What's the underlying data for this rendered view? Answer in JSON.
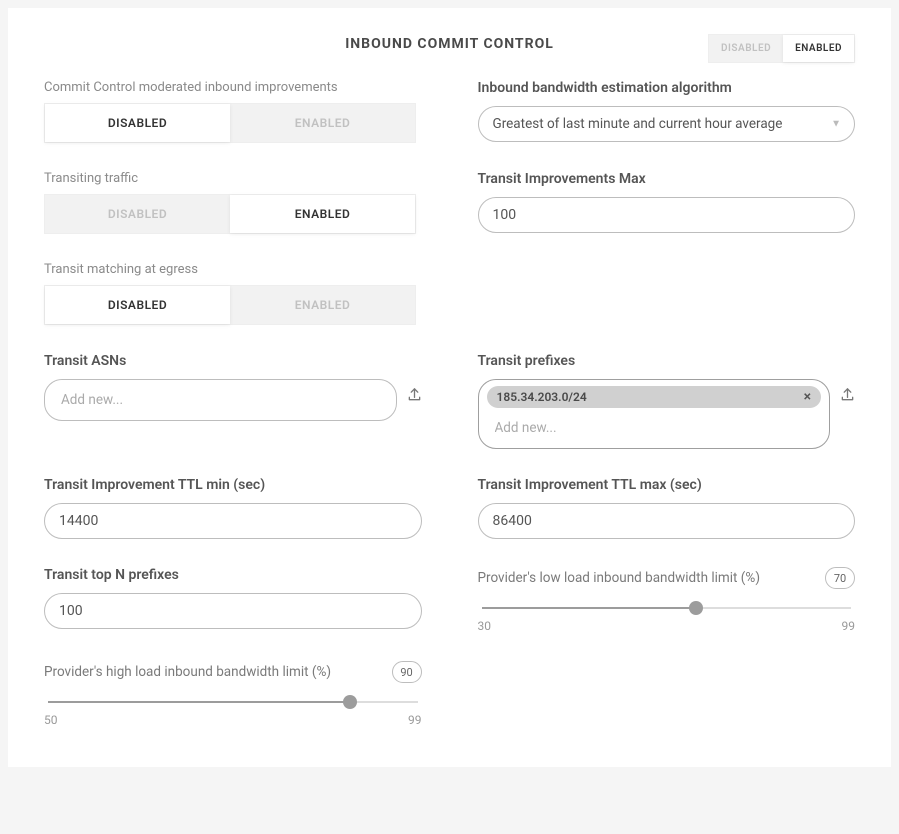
{
  "title": "INBOUND COMMIT CONTROL",
  "header_toggle": {
    "disabled": "DISABLED",
    "enabled": "ENABLED",
    "active": "enabled"
  },
  "moderated": {
    "label": "Commit Control moderated inbound improvements",
    "disabled": "DISABLED",
    "enabled": "ENABLED",
    "active": "disabled"
  },
  "algorithm": {
    "label": "Inbound bandwidth estimation algorithm",
    "value": "Greatest of last minute and current hour average"
  },
  "transiting": {
    "label": "Transiting traffic",
    "disabled": "DISABLED",
    "enabled": "ENABLED",
    "active": "enabled"
  },
  "improv_max": {
    "label": "Transit Improvements Max",
    "value": "100"
  },
  "egress_match": {
    "label": "Transit matching at egress",
    "disabled": "DISABLED",
    "enabled": "ENABLED",
    "active": "disabled"
  },
  "asns": {
    "label": "Transit ASNs",
    "placeholder": "Add new...",
    "tags": []
  },
  "prefixes": {
    "label": "Transit prefixes",
    "placeholder": "Add new...",
    "tags": [
      "185.34.203.0/24"
    ]
  },
  "ttl_min": {
    "label": "Transit Improvement TTL min (sec)",
    "value": "14400"
  },
  "ttl_max": {
    "label": "Transit Improvement TTL max (sec)",
    "value": "86400"
  },
  "top_n": {
    "label": "Transit top N prefixes",
    "value": "100"
  },
  "low_load": {
    "label": "Provider's low load inbound bandwidth limit (%)",
    "value": 70,
    "min": 30,
    "max": 99
  },
  "high_load": {
    "label": "Provider's high load inbound bandwidth limit (%)",
    "value": 90,
    "min": 50,
    "max": 99
  }
}
